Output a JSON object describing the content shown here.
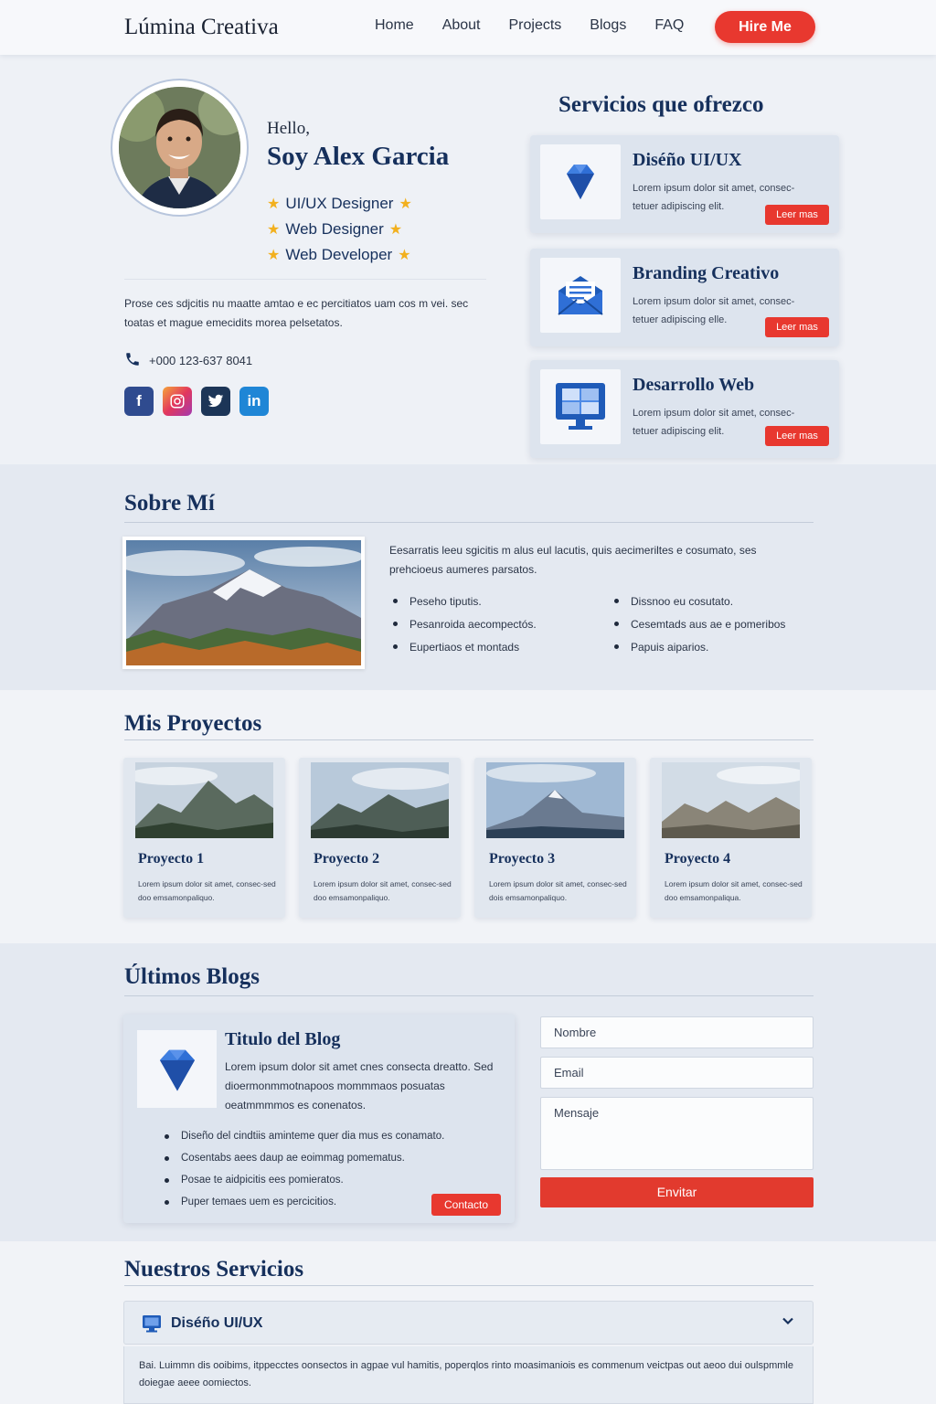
{
  "header": {
    "brand": "Lúmina Creativa",
    "nav": [
      "Home",
      "About",
      "Projects",
      "Blogs",
      "FAQ"
    ],
    "cta": "Hire Me"
  },
  "hero": {
    "greeting": "Hello,",
    "name": "Soy Alex Garcia",
    "roles": [
      "UI/UX Designer",
      "Web Designer",
      "Web Developer"
    ],
    "intro": "Prose ces sdjcitis nu maatte amtao e ec percitiatos uam cos m vei. sec toatas et mague emecidits morea pelsetatos.",
    "phone": "+000 123-637 8041",
    "socials": [
      "facebook",
      "instagram",
      "twitter",
      "linkedin"
    ]
  },
  "services_side": {
    "title": "Servicios que ofrezco",
    "items": [
      {
        "title": "Diséño UI/UX",
        "desc": "Lorem ipsum dolor sit amet, consec-tetuer adipiscing elit.",
        "btn": "Leer mas",
        "icon": "diamond-icon"
      },
      {
        "title": "Branding Creativo",
        "desc": "Lorem ipsum dolor sit amet, consec-tetuer adipiscing elle.",
        "btn": "Leer mas",
        "icon": "mail-icon"
      },
      {
        "title": "Desarrollo Web",
        "desc": "Lorem ipsum dolor sit amet, consec-tetuer adipiscing elit.",
        "btn": "Leer mas",
        "icon": "monitor-icon"
      }
    ]
  },
  "about": {
    "title": "Sobre Mí",
    "text": "Eesarratis leeu sgicitis m alus eul lacutis, quis aecimeriltes e cosumato, ses prehcioeus aumeres parsatos.",
    "list_left": [
      "Peseho tiputis.",
      "Pesanroida aecompectós.",
      "Eupertiaos et montads"
    ],
    "list_right": [
      "Dissnoo eu cosutato.",
      "Cesemtads aus ae e pomeribos",
      "Papuis aiparios."
    ]
  },
  "projects": {
    "title": "Mis Proyectos",
    "items": [
      {
        "title": "Proyecto 1",
        "desc": "Lorem ipsum dolor sit amet, consec-sed doo emsamonpaliquo."
      },
      {
        "title": "Proyecto 2",
        "desc": "Lorem ipsum dolor sit amet, consec-sed doo emsamonpaliquo."
      },
      {
        "title": "Proyecto 3",
        "desc": "Lorem ipsum dolor sit amet, consec-sed dois emsamonpaliquo."
      },
      {
        "title": "Proyecto 4",
        "desc": "Lorem ipsum dolor sit amet, consec-sed doo emsamonpaliqua."
      }
    ]
  },
  "blogs": {
    "title": "Últimos Blogs",
    "post_title": "Titulo del Blog",
    "post_desc": "Lorem ipsum dolor sit amet cnes consecta dreatto. Sed dioermonmmotnapoos mommmaos posuatas oeatmmmmos es conenatos.",
    "list": [
      "Diseño del cindtiis aminteme quer dia mus es conamato.",
      "Cosentabs aees daup ae eoimmag pomematus.",
      "Posae te aidpicitis ees pomieratos.",
      "Puper temaes uem es percicitios."
    ],
    "btn": "Contacto"
  },
  "form": {
    "name_placeholder": "Nombre",
    "email_placeholder": "Email",
    "message_placeholder": "Mensaje",
    "submit": "Envitar"
  },
  "faq": {
    "title": "Nuestros Servicios",
    "item_title": "Diséño UI/UX",
    "item_body": "Bai. Luimmn dis ooibims, itppecctes oonsectos in agpae vul hamitis, poperqlos rinto moasimaniois es commenum veictpas out aeoo dui oulspmmle doiegae aeee oomiectos."
  },
  "colors": {
    "accent": "#e8382f",
    "navy": "#16305c",
    "star": "#f2b01e"
  }
}
